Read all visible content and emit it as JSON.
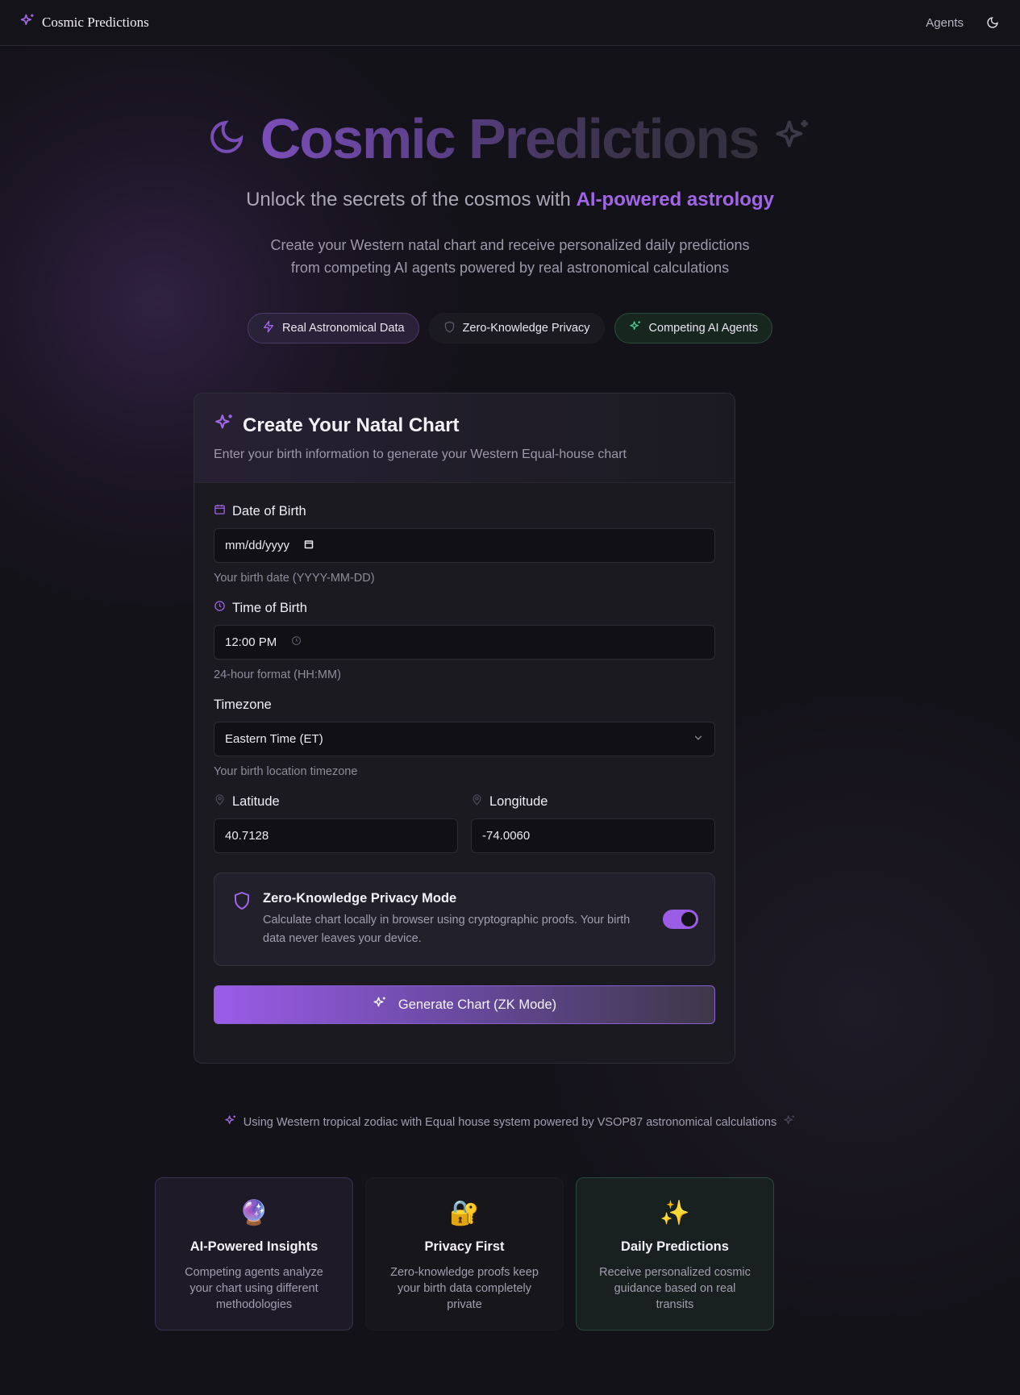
{
  "nav": {
    "brand": "Cosmic Predictions",
    "agents_link": "Agents"
  },
  "hero": {
    "title": "Cosmic Predictions",
    "subtitle_prefix": "Unlock the secrets of the cosmos with ",
    "subtitle_accent": "AI-powered astrology",
    "desc_line1": "Create your Western natal chart and receive personalized daily predictions",
    "desc_line2": "from competing AI agents powered by real astronomical calculations"
  },
  "pills": {
    "real_data": "Real Astronomical Data",
    "zk_privacy": "Zero-Knowledge Privacy",
    "competing_agents": "Competing AI Agents"
  },
  "form": {
    "title": "Create Your Natal Chart",
    "description": "Enter your birth information to generate your Western Equal-house chart",
    "dob": {
      "label": "Date of Birth",
      "value": "mm/dd/yyyy",
      "help": "Your birth date (YYYY-MM-DD)"
    },
    "tob": {
      "label": "Time of Birth",
      "value": "12:00 PM",
      "help": "24-hour format (HH:MM)"
    },
    "timezone": {
      "label": "Timezone",
      "value": "Eastern Time (ET)",
      "help": "Your birth location timezone"
    },
    "latitude": {
      "label": "Latitude",
      "value": "40.7128"
    },
    "longitude": {
      "label": "Longitude",
      "value": "-74.0060"
    },
    "zk": {
      "title": "Zero-Knowledge Privacy Mode",
      "desc": "Calculate chart locally in browser using cryptographic proofs. Your birth data never leaves your device.",
      "enabled": true
    },
    "submit_label": "Generate Chart (ZK Mode)"
  },
  "footnote": "Using Western tropical zodiac with Equal house system powered by VSOP87 astronomical calculations",
  "features": [
    {
      "icon": "crystal-ball",
      "emoji": "🔮",
      "title": "AI-Powered Insights",
      "desc": "Competing agents analyze your chart using different methodologies"
    },
    {
      "icon": "lock-with-key",
      "emoji": "🔐",
      "title": "Privacy First",
      "desc": "Zero-knowledge proofs keep your birth data completely private"
    },
    {
      "icon": "sparkles",
      "emoji": "✨",
      "title": "Daily Predictions",
      "desc": "Receive personalized cosmic guidance based on real transits"
    }
  ],
  "colors": {
    "accent": "#9b5de5",
    "green": "#3ecf8e",
    "background": "#141219"
  }
}
